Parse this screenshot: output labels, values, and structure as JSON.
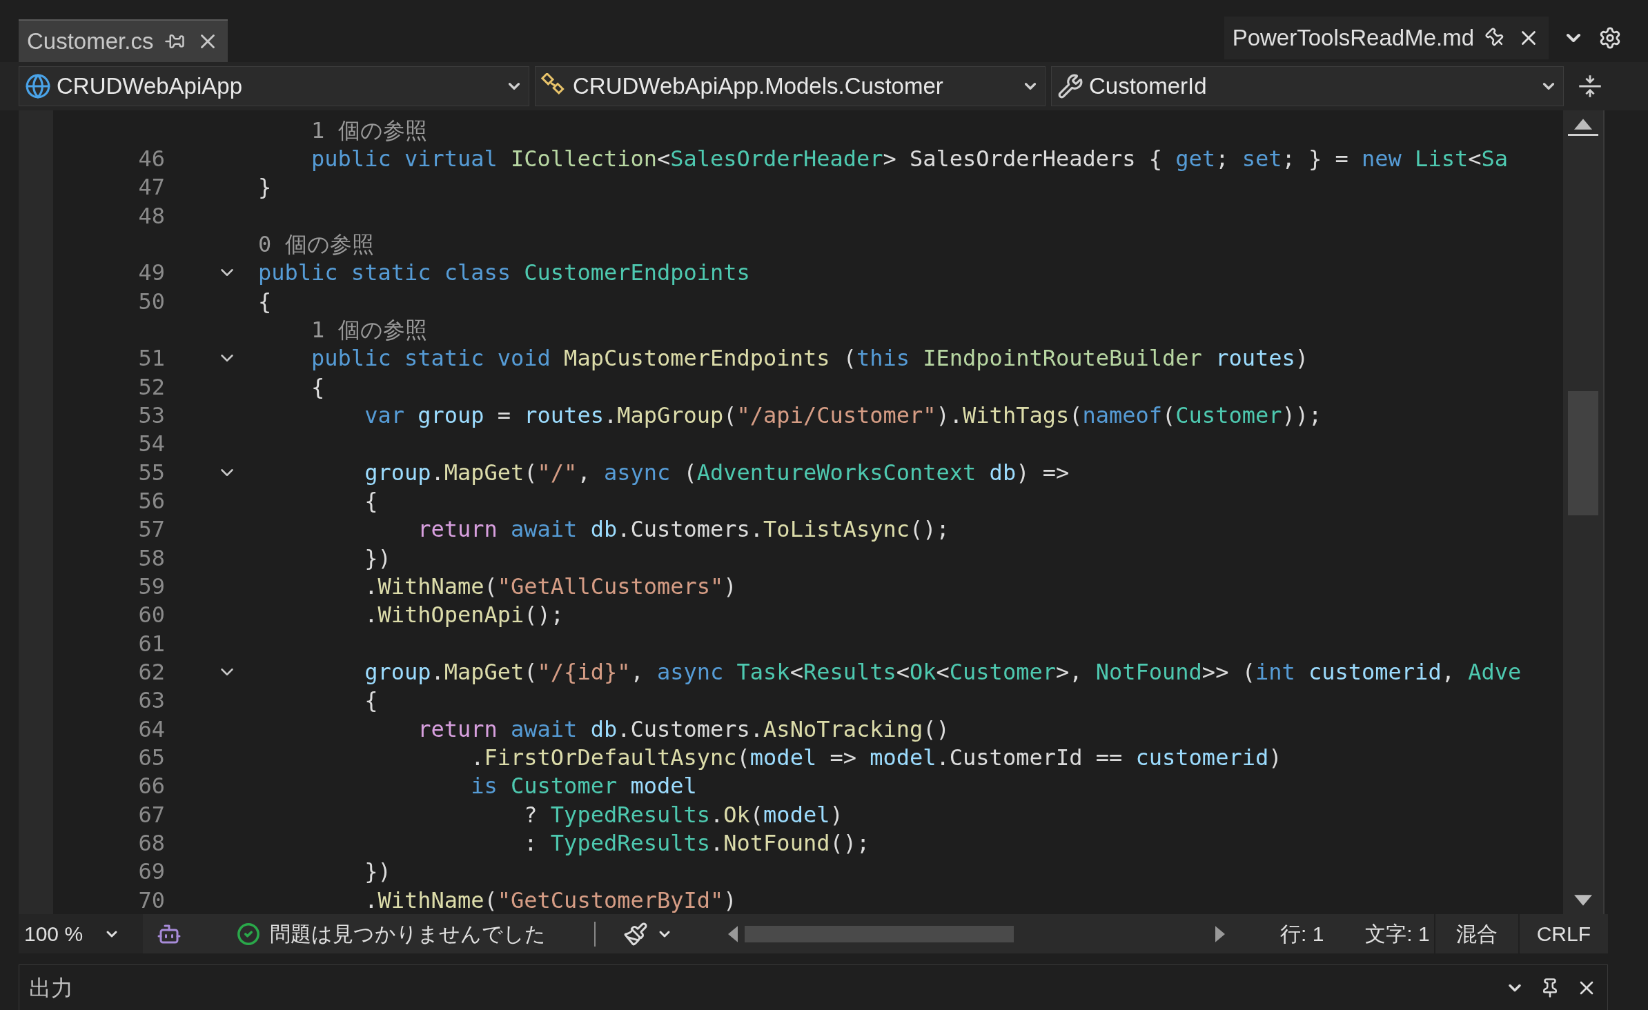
{
  "tabs": [
    {
      "label": "Customer.cs",
      "selected": true
    },
    {
      "label": "PowerToolsReadMe.md",
      "selected": false
    }
  ],
  "nav": {
    "project": "CRUDWebApiApp",
    "type": "CRUDWebApiApp.Models.Customer",
    "member": "CustomerId"
  },
  "lines": [
    {
      "kind": "lens",
      "text": "    1 個の参照"
    },
    {
      "kind": "code",
      "number": "46",
      "tokens": [
        {
          "text": "    public virtual ",
          "kind": "kw"
        },
        {
          "text": "ICollection",
          "kind": "iface"
        },
        {
          "text": "<",
          "kind": "plain"
        },
        {
          "text": "SalesOrderHeader",
          "kind": "type"
        },
        {
          "text": "> SalesOrderHeaders { ",
          "kind": "plain"
        },
        {
          "text": "get",
          "kind": "kw"
        },
        {
          "text": "; ",
          "kind": "plain"
        },
        {
          "text": "set",
          "kind": "kw"
        },
        {
          "text": "; } = ",
          "kind": "plain"
        },
        {
          "text": "new ",
          "kind": "kw"
        },
        {
          "text": "List",
          "kind": "type"
        },
        {
          "text": "<",
          "kind": "plain"
        },
        {
          "text": "Sa",
          "kind": "type"
        }
      ]
    },
    {
      "kind": "code",
      "number": "47",
      "tokens": [
        {
          "text": "}",
          "kind": "plain"
        }
      ]
    },
    {
      "kind": "code",
      "number": "48"
    },
    {
      "kind": "lens",
      "text": "0 個の参照"
    },
    {
      "kind": "code",
      "number": "49",
      "expanded": true,
      "tokens": [
        {
          "text": "public static class ",
          "kind": "kw"
        },
        {
          "text": "CustomerEndpoints",
          "kind": "type"
        }
      ]
    },
    {
      "kind": "code",
      "number": "50",
      "tokens": [
        {
          "text": "{",
          "kind": "plain"
        }
      ]
    },
    {
      "kind": "lens",
      "text": "    1 個の参照"
    },
    {
      "kind": "code",
      "number": "51",
      "expanded": true,
      "tokens": [
        {
          "text": "    public static void ",
          "kind": "kw"
        },
        {
          "text": "MapCustomerEndpoints",
          "kind": "method"
        },
        {
          "text": " (",
          "kind": "plain"
        },
        {
          "text": "this ",
          "kind": "kw"
        },
        {
          "text": "IEndpointRouteBuilder ",
          "kind": "iface"
        },
        {
          "text": "routes",
          "kind": "var"
        },
        {
          "text": ")",
          "kind": "plain"
        }
      ]
    },
    {
      "kind": "code",
      "number": "52",
      "tokens": [
        {
          "text": "    {",
          "kind": "plain"
        }
      ]
    },
    {
      "kind": "code",
      "number": "53",
      "tokens": [
        {
          "text": "        var ",
          "kind": "kw"
        },
        {
          "text": "group",
          "kind": "var"
        },
        {
          "text": " = ",
          "kind": "plain"
        },
        {
          "text": "routes",
          "kind": "var"
        },
        {
          "text": ".",
          "kind": "plain"
        },
        {
          "text": "MapGroup",
          "kind": "method"
        },
        {
          "text": "(",
          "kind": "plain"
        },
        {
          "text": "\"/api/Customer\"",
          "kind": "str"
        },
        {
          "text": ").",
          "kind": "plain"
        },
        {
          "text": "WithTags",
          "kind": "method"
        },
        {
          "text": "(",
          "kind": "plain"
        },
        {
          "text": "nameof",
          "kind": "kw"
        },
        {
          "text": "(",
          "kind": "plain"
        },
        {
          "text": "Customer",
          "kind": "type"
        },
        {
          "text": "));",
          "kind": "plain"
        }
      ]
    },
    {
      "kind": "code",
      "number": "54"
    },
    {
      "kind": "code",
      "number": "55",
      "expanded": true,
      "tokens": [
        {
          "text": "        group",
          "kind": "var"
        },
        {
          "text": ".",
          "kind": "plain"
        },
        {
          "text": "MapGet",
          "kind": "method"
        },
        {
          "text": "(",
          "kind": "plain"
        },
        {
          "text": "\"/\"",
          "kind": "str"
        },
        {
          "text": ", ",
          "kind": "plain"
        },
        {
          "text": "async ",
          "kind": "kw"
        },
        {
          "text": "(",
          "kind": "plain"
        },
        {
          "text": "AdventureWorksContext ",
          "kind": "type"
        },
        {
          "text": "db",
          "kind": "var"
        },
        {
          "text": ") =>",
          "kind": "plain"
        }
      ]
    },
    {
      "kind": "code",
      "number": "56",
      "tokens": [
        {
          "text": "        {",
          "kind": "plain"
        }
      ]
    },
    {
      "kind": "code",
      "number": "57",
      "tokens": [
        {
          "text": "            return ",
          "kind": "ctl"
        },
        {
          "text": "await ",
          "kind": "kw"
        },
        {
          "text": "db",
          "kind": "var"
        },
        {
          "text": ".Customers.",
          "kind": "plain"
        },
        {
          "text": "ToListAsync",
          "kind": "method"
        },
        {
          "text": "();",
          "kind": "plain"
        }
      ]
    },
    {
      "kind": "code",
      "number": "58",
      "tokens": [
        {
          "text": "        })",
          "kind": "plain"
        }
      ]
    },
    {
      "kind": "code",
      "number": "59",
      "tokens": [
        {
          "text": "        .",
          "kind": "plain"
        },
        {
          "text": "WithName",
          "kind": "method"
        },
        {
          "text": "(",
          "kind": "plain"
        },
        {
          "text": "\"GetAllCustomers\"",
          "kind": "str"
        },
        {
          "text": ")",
          "kind": "plain"
        }
      ]
    },
    {
      "kind": "code",
      "number": "60",
      "tokens": [
        {
          "text": "        .",
          "kind": "plain"
        },
        {
          "text": "WithOpenApi",
          "kind": "method"
        },
        {
          "text": "();",
          "kind": "plain"
        }
      ]
    },
    {
      "kind": "code",
      "number": "61"
    },
    {
      "kind": "code",
      "number": "62",
      "expanded": true,
      "tokens": [
        {
          "text": "        group",
          "kind": "var"
        },
        {
          "text": ".",
          "kind": "plain"
        },
        {
          "text": "MapGet",
          "kind": "method"
        },
        {
          "text": "(",
          "kind": "plain"
        },
        {
          "text": "\"/{id}\"",
          "kind": "str"
        },
        {
          "text": ", ",
          "kind": "plain"
        },
        {
          "text": "async ",
          "kind": "kw"
        },
        {
          "text": "Task",
          "kind": "type"
        },
        {
          "text": "<",
          "kind": "plain"
        },
        {
          "text": "Results",
          "kind": "type"
        },
        {
          "text": "<",
          "kind": "plain"
        },
        {
          "text": "Ok",
          "kind": "type"
        },
        {
          "text": "<",
          "kind": "plain"
        },
        {
          "text": "Customer",
          "kind": "type"
        },
        {
          "text": ">, ",
          "kind": "plain"
        },
        {
          "text": "NotFound",
          "kind": "type"
        },
        {
          "text": ">> (",
          "kind": "plain"
        },
        {
          "text": "int ",
          "kind": "kw"
        },
        {
          "text": "customerid",
          "kind": "var"
        },
        {
          "text": ", ",
          "kind": "plain"
        },
        {
          "text": "Adve",
          "kind": "type"
        }
      ]
    },
    {
      "kind": "code",
      "number": "63",
      "tokens": [
        {
          "text": "        {",
          "kind": "plain"
        }
      ]
    },
    {
      "kind": "code",
      "number": "64",
      "tokens": [
        {
          "text": "            return ",
          "kind": "ctl"
        },
        {
          "text": "await ",
          "kind": "kw"
        },
        {
          "text": "db",
          "kind": "var"
        },
        {
          "text": ".Customers.",
          "kind": "plain"
        },
        {
          "text": "AsNoTracking",
          "kind": "method"
        },
        {
          "text": "()",
          "kind": "plain"
        }
      ]
    },
    {
      "kind": "code",
      "number": "65",
      "tokens": [
        {
          "text": "                .",
          "kind": "plain"
        },
        {
          "text": "FirstOrDefaultAsync",
          "kind": "method"
        },
        {
          "text": "(",
          "kind": "plain"
        },
        {
          "text": "model",
          "kind": "var"
        },
        {
          "text": " => ",
          "kind": "plain"
        },
        {
          "text": "model",
          "kind": "var"
        },
        {
          "text": ".CustomerId == ",
          "kind": "plain"
        },
        {
          "text": "customerid",
          "kind": "var"
        },
        {
          "text": ")",
          "kind": "plain"
        }
      ]
    },
    {
      "kind": "code",
      "number": "66",
      "tokens": [
        {
          "text": "                is ",
          "kind": "kw"
        },
        {
          "text": "Customer ",
          "kind": "type"
        },
        {
          "text": "model",
          "kind": "var"
        }
      ]
    },
    {
      "kind": "code",
      "number": "67",
      "tokens": [
        {
          "text": "                    ? ",
          "kind": "plain"
        },
        {
          "text": "TypedResults",
          "kind": "type"
        },
        {
          "text": ".",
          "kind": "plain"
        },
        {
          "text": "Ok",
          "kind": "method"
        },
        {
          "text": "(",
          "kind": "plain"
        },
        {
          "text": "model",
          "kind": "var"
        },
        {
          "text": ")",
          "kind": "plain"
        }
      ]
    },
    {
      "kind": "code",
      "number": "68",
      "tokens": [
        {
          "text": "                    : ",
          "kind": "plain"
        },
        {
          "text": "TypedResults",
          "kind": "type"
        },
        {
          "text": ".",
          "kind": "plain"
        },
        {
          "text": "NotFound",
          "kind": "method"
        },
        {
          "text": "();",
          "kind": "plain"
        }
      ]
    },
    {
      "kind": "code",
      "number": "69",
      "tokens": [
        {
          "text": "        })",
          "kind": "plain"
        }
      ]
    },
    {
      "kind": "code",
      "number": "70",
      "tokens": [
        {
          "text": "        .",
          "kind": "plain"
        },
        {
          "text": "WithName",
          "kind": "method"
        },
        {
          "text": "(",
          "kind": "plain"
        },
        {
          "text": "\"GetCustomerById\"",
          "kind": "str"
        },
        {
          "text": ")",
          "kind": "plain"
        }
      ]
    }
  ],
  "status": {
    "zoom": "100 %",
    "message": "問題は見つかりませんでした",
    "line": "行: 1",
    "column": "文字: 1",
    "encoding": "混合",
    "eol": "CRLF"
  },
  "output": {
    "title": "出力"
  }
}
